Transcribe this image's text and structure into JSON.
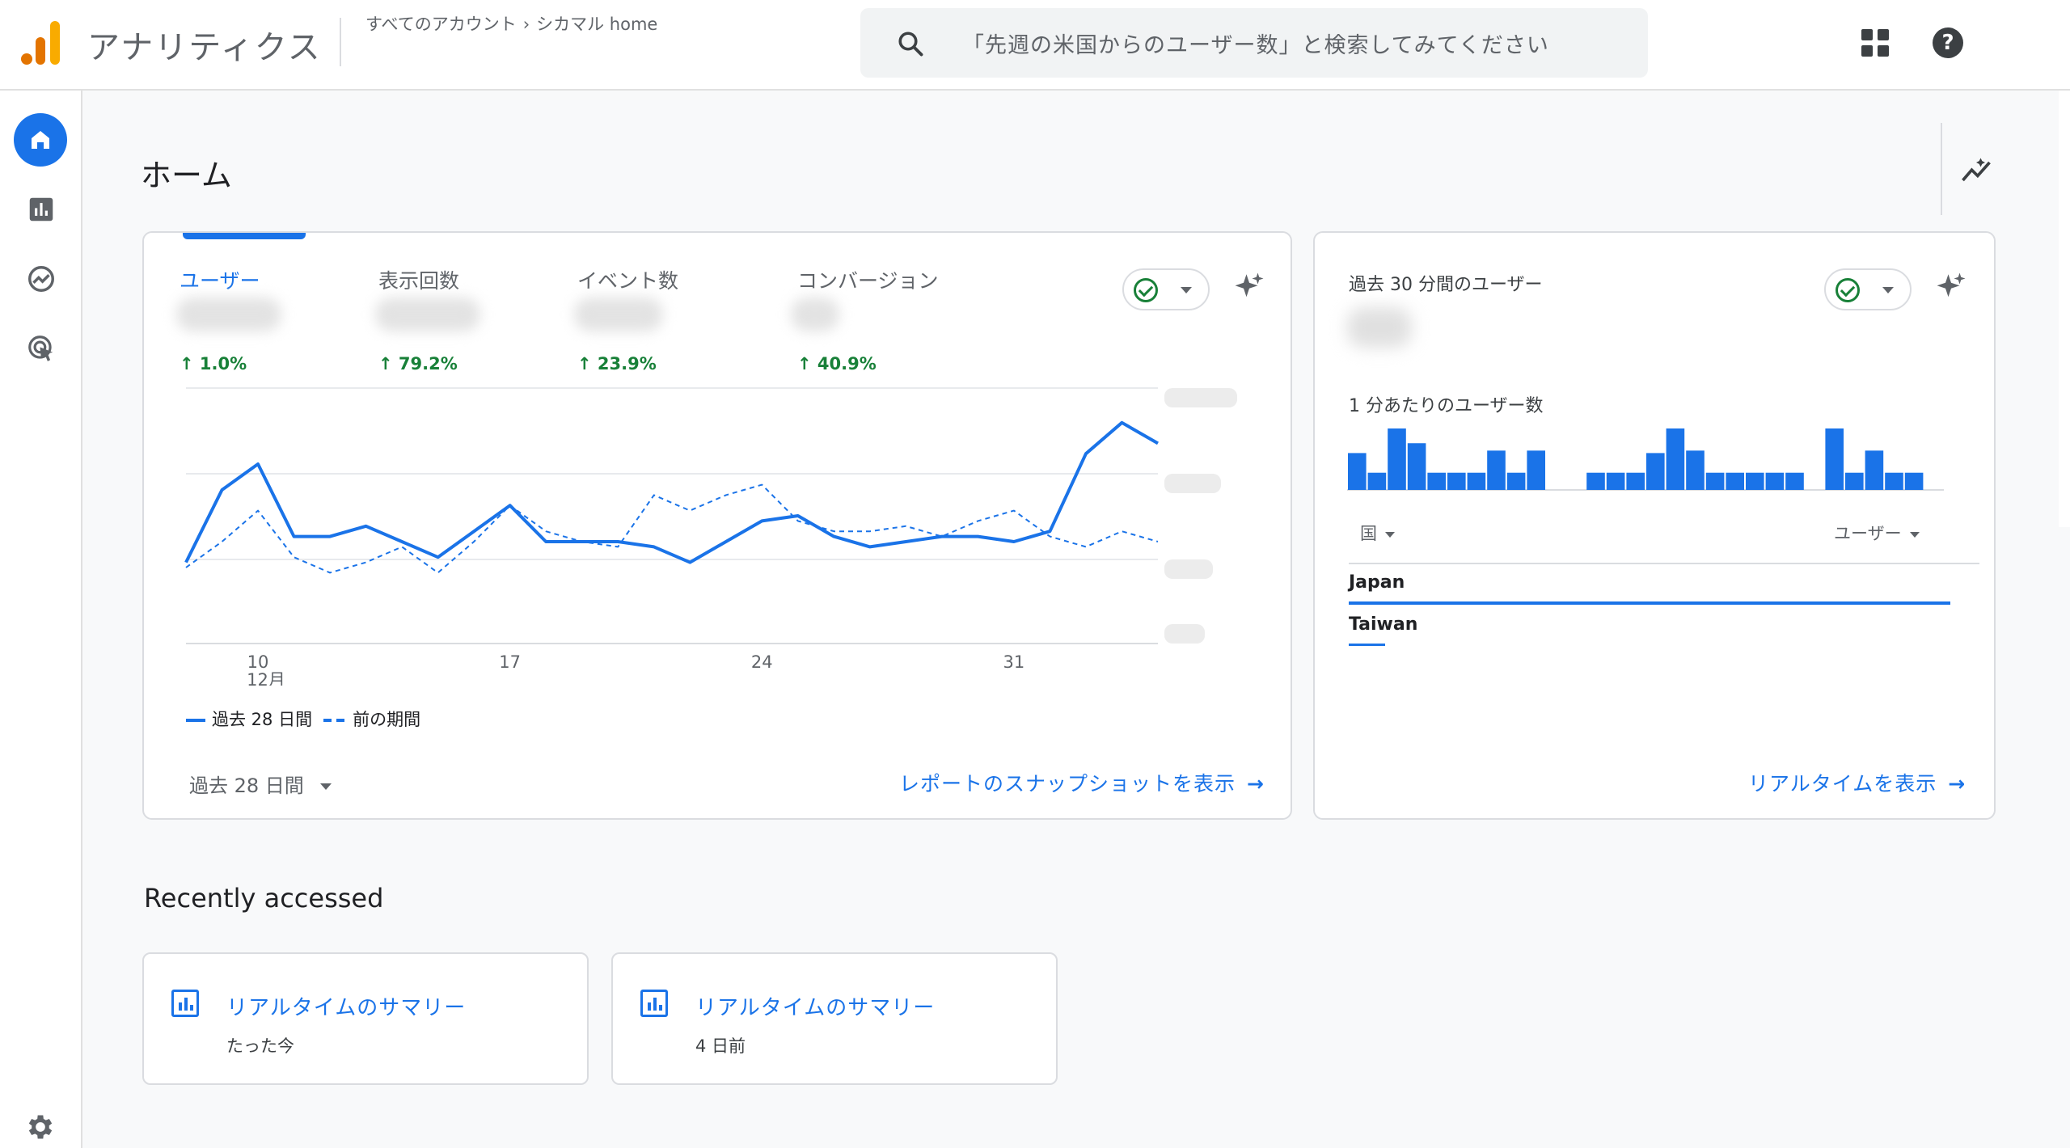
{
  "app": {
    "title": "アナリティクス"
  },
  "breadcrumb": {
    "account": "すべてのアカウント",
    "separator": "›",
    "property": "シカマル home"
  },
  "search": {
    "placeholder": "「先週の米国からのユーザー数」と検索してみてください"
  },
  "header": {
    "icons": [
      "apps-icon",
      "help-icon"
    ],
    "help_glyph": "?"
  },
  "sidebar": {
    "items": [
      {
        "name": "home",
        "icon": "home-icon",
        "active": true
      },
      {
        "name": "reports",
        "icon": "bar-chart-icon"
      },
      {
        "name": "explore",
        "icon": "explore-icon"
      },
      {
        "name": "advertising",
        "icon": "target-cursor-icon"
      }
    ],
    "settings_icon": "gear-icon"
  },
  "page": {
    "title": "ホーム"
  },
  "overview_card": {
    "metrics": [
      {
        "label": "ユーザー",
        "change": "1.0%",
        "active": true
      },
      {
        "label": "表示回数",
        "change": "79.2%"
      },
      {
        "label": "イベント数",
        "change": "23.9%"
      },
      {
        "label": "コンバージョン",
        "change": "40.9%"
      }
    ],
    "legend": {
      "current": "過去 28 日間",
      "previous": "前の期間"
    },
    "date_range": "過去 28 日間",
    "link": "レポートのスナップショットを表示",
    "link_arrow": "→"
  },
  "chart_data": {
    "type": "line",
    "x_ticks": [
      {
        "label": "10",
        "sub": "12月"
      },
      {
        "label": "17"
      },
      {
        "label": "24"
      },
      {
        "label": "31"
      }
    ],
    "series": [
      {
        "name": "過去 28 日間",
        "style": "solid",
        "values": [
          46,
          60,
          65,
          51,
          51,
          53,
          50,
          47,
          52,
          57,
          50,
          50,
          50,
          49,
          46,
          50,
          54,
          55,
          51,
          49,
          50,
          51,
          51,
          50,
          52,
          67,
          73,
          69
        ]
      },
      {
        "name": "前の期間",
        "style": "dashed",
        "values": [
          45,
          50,
          56,
          47,
          44,
          46,
          49,
          44,
          50,
          57,
          52,
          50,
          49,
          59,
          56,
          59,
          61,
          54,
          52,
          52,
          53,
          51,
          54,
          56,
          51,
          49,
          52,
          50
        ]
      }
    ],
    "colors": {
      "line": "#1a73e8",
      "grid": "#e8eaed"
    }
  },
  "realtime_card": {
    "title": "過去 30 分間のユーザー",
    "subtitle": "1 分あたりのユーザー数",
    "minute_bars": [
      3,
      1.4,
      5,
      3.8,
      1.4,
      1.4,
      1.4,
      3.2,
      1.4,
      3.2,
      0,
      0,
      1.4,
      1.4,
      1.4,
      3,
      5,
      3.2,
      1.4,
      1.4,
      1.4,
      1.4,
      1.4,
      0,
      5,
      1.4,
      3.2,
      1.4,
      1.4,
      0
    ],
    "dim_label": "国",
    "metric_label": "ユーザー",
    "rows": [
      {
        "country": "Japan",
        "share": 1.0
      },
      {
        "country": "Taiwan",
        "share": 0.06
      }
    ],
    "link": "リアルタイムを表示",
    "link_arrow": "→"
  },
  "recent": {
    "title": "Recently accessed",
    "items": [
      {
        "title": "リアルタイムのサマリー",
        "time": "たった今"
      },
      {
        "title": "リアルタイムのサマリー",
        "time": "4 日前"
      }
    ]
  }
}
